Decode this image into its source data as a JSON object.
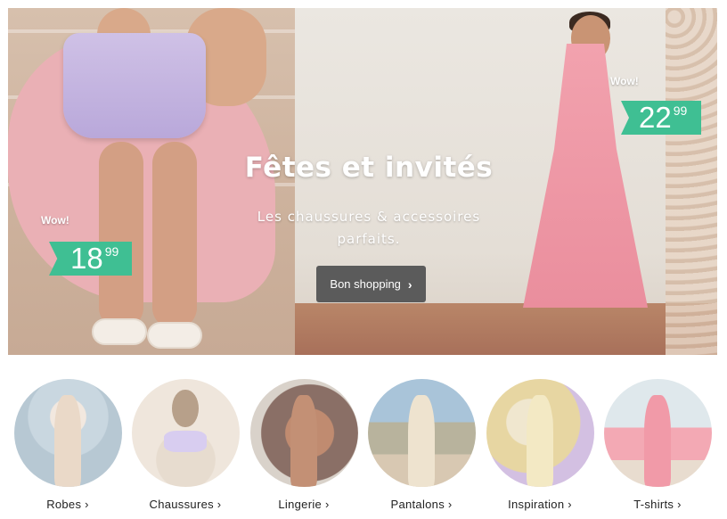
{
  "hero": {
    "title": "Fêtes et invités",
    "subtitle_line1": "Les chaussures & accessoires",
    "subtitle_line2": "parfaits.",
    "cta_label": "Bon shopping",
    "cta_icon": "chevron-right-icon",
    "price_left": {
      "badge": "Wow!",
      "main": "18",
      "cents": "99"
    },
    "price_right": {
      "badge": "Wow!",
      "main": "22",
      "cents": "99"
    },
    "colors": {
      "price_tag": "#3fbf93",
      "cta": "#5b5b5b"
    }
  },
  "categories": [
    {
      "label": "Robes ›"
    },
    {
      "label": "Chaussures ›"
    },
    {
      "label": "Lingerie ›"
    },
    {
      "label": "Pantalons ›"
    },
    {
      "label": "Inspiration ›"
    },
    {
      "label": "T-shirts ›"
    }
  ]
}
